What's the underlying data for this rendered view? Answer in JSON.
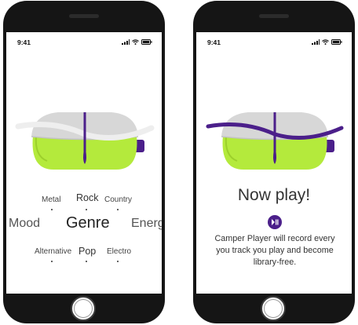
{
  "left_screen": {
    "status": {
      "time": "9:41"
    },
    "picker": {
      "center": "Genre",
      "left": "Mood",
      "right": "Energy",
      "top": [
        "Metal",
        "Rock",
        "Country"
      ],
      "bottom": [
        "Alternative",
        "Pop",
        "Electro"
      ]
    }
  },
  "right_screen": {
    "status": {
      "time": "9:41"
    },
    "title": "Now play!",
    "play_icon": "play-pause-icon",
    "description": "Camper Player will record every you track you play and become library-free."
  },
  "colors": {
    "accent": "#4b1f8a",
    "lime": "#b4ea3c",
    "grey": "#d4d4d4"
  }
}
